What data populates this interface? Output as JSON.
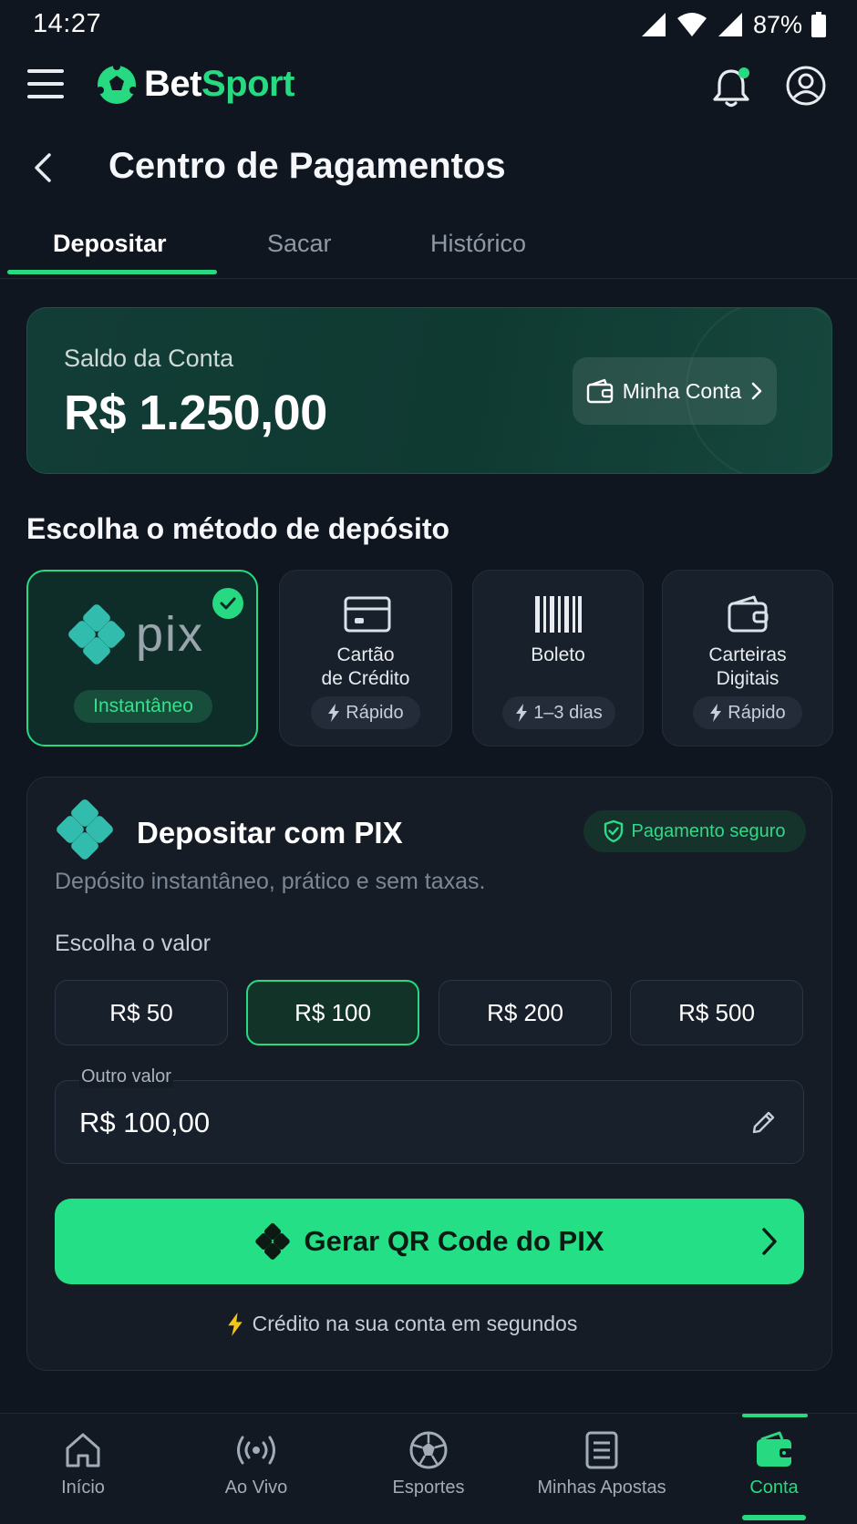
{
  "status_bar": {
    "time": "14:27",
    "battery": "87%"
  },
  "header": {
    "logo_part1": "Bet",
    "logo_part2": "Sport"
  },
  "page": {
    "title": "Centro de Pagamentos"
  },
  "tabs": [
    {
      "label": "Depositar",
      "active": true
    },
    {
      "label": "Sacar",
      "active": false
    },
    {
      "label": "Histórico",
      "active": false
    }
  ],
  "balance": {
    "label": "Saldo da Conta",
    "value": "R$ 1.250,00",
    "account_button": "Minha Conta"
  },
  "methods_section": {
    "title": "Escolha o método de depósito",
    "methods": [
      {
        "label": "pix",
        "chip": "Instantâneo",
        "selected": true,
        "icon": "pix-logo-icon"
      },
      {
        "label_line1": "Cartão",
        "label_line2": "de Crédito",
        "chip": "Rápido",
        "icon": "credit-card-icon"
      },
      {
        "label": "Boleto",
        "chip": "1–3 dias",
        "icon": "barcode-icon"
      },
      {
        "label_line1": "Carteiras",
        "label_line2": "Digitais",
        "chip": "Rápido",
        "icon": "wallet-icon"
      }
    ]
  },
  "pix_card": {
    "title": "Depositar com PIX",
    "secure_badge": "Pagamento seguro",
    "description": "Depósito instantâneo, prático e sem taxas.",
    "value_label": "Escolha o valor",
    "amounts": [
      "R$ 50",
      "R$ 100",
      "R$ 200",
      "R$ 500"
    ],
    "selected_amount": "R$ 100",
    "other_label": "Outro valor",
    "other_value": "R$ 100,00",
    "cta": "Gerar QR Code do PIX",
    "credit_note": "Crédito na sua conta em segundos"
  },
  "bottom_nav": [
    {
      "label": "Início",
      "icon": "home-icon"
    },
    {
      "label": "Ao Vivo",
      "icon": "live-broadcast-icon"
    },
    {
      "label": "Esportes",
      "icon": "soccer-ball-icon"
    },
    {
      "label": "Minhas Apostas",
      "icon": "bet-slip-icon"
    },
    {
      "label": "Conta",
      "icon": "wallet-icon",
      "active": true
    }
  ],
  "colors": {
    "accent": "#27d980",
    "background": "#10161f",
    "card": "#151c26"
  }
}
